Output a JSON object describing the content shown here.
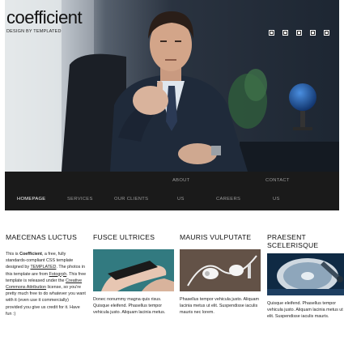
{
  "brand": {
    "title": "coefficient",
    "tagline": "DESIGN BY TEMPLATED"
  },
  "slider": {
    "dot_count": 5
  },
  "nav": {
    "items": [
      {
        "label": "HOMEPAGE",
        "active": true
      },
      {
        "label": "SERVICES"
      },
      {
        "label": "OUR CLIENTS"
      },
      {
        "label_top": "ABOUT",
        "label_bottom": "US"
      },
      {
        "label": "CAREERS"
      },
      {
        "label_top": "CONTACT",
        "label_bottom": "US"
      }
    ]
  },
  "columns": [
    {
      "heading": "MAECENAS LUCTUS",
      "intro": {
        "p1": "This is ",
        "brand": "Coefficient",
        "p2": ", a free, fully standards-compliant CSS template designed by ",
        "link1": "TEMPLATED",
        "p3": ". The photos in this template are from ",
        "link2": "Fotogrph",
        "p4": ". This free template is released under the ",
        "link3": "Creative Commons Attribution",
        "p5": " license, so you're pretty much free to do whatever you want with it (even use it commercially) provided you give us credit for it. Have fun :)"
      }
    },
    {
      "heading": "FUSCE ULTRICES",
      "image": "hand-with-phone",
      "text": "Donec nonummy magna quis risus. Quisque eleifend. Phasellus tempor vehicula justo. Aliquam lacinia metus."
    },
    {
      "heading": "MAURIS VULPUTATE",
      "image": "white-earphones",
      "text": "Phasellus tempor vehicula justo. Aliquam lacinia metus ut elit. Suspendisse iaculis mauris nec lorem."
    },
    {
      "heading": "PRAESENT SCELERISQUE",
      "image": "hard-disk-drive",
      "text": "Quisque eleifend. Phasellus tempor vehicula justo. Aliquam lacinia metus ut elit. Suspendisse iaculis mauris."
    }
  ],
  "colors": {
    "nav_bg": "#1a1a1a",
    "nav_text": "#9a9a9a",
    "nav_active": "#ffffff"
  }
}
